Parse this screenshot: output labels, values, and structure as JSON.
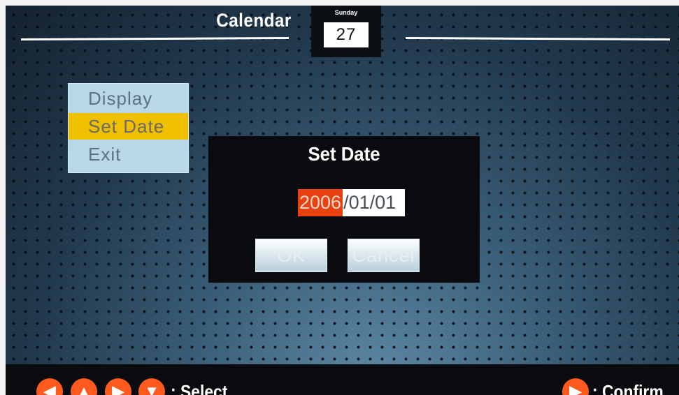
{
  "header": {
    "title": "Calendar",
    "calendar_icon": {
      "day_name": "Sunday",
      "day_number": "27"
    }
  },
  "menu": {
    "items": [
      {
        "label": "Display",
        "selected": false
      },
      {
        "label": "Set Date",
        "selected": true
      },
      {
        "label": "Exit",
        "selected": false
      }
    ]
  },
  "dialog": {
    "title": "Set Date",
    "date": {
      "year": "2006",
      "rest": "/01/01"
    },
    "ok_label": "OK",
    "cancel_label": "Cancel"
  },
  "footer": {
    "select_icons": [
      "left-arrow-icon",
      "up-arrow-icon",
      "right-arrow-icon",
      "down-arrow-icon"
    ],
    "select_label": ": Select",
    "confirm_icon": "play-icon",
    "confirm_label": ": Confirm"
  },
  "colors": {
    "highlight": "#f0c000",
    "selected_field": "#e8400e",
    "nav_icon": "#ff5a1e"
  }
}
